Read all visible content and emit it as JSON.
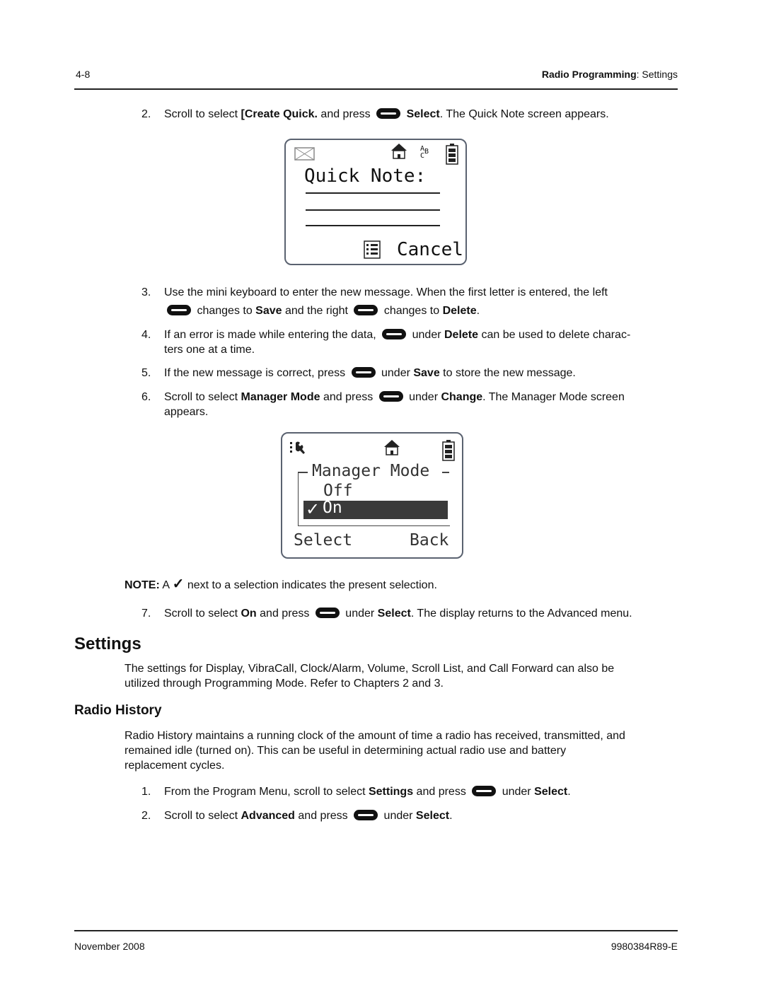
{
  "header": {
    "page_number": "4-8",
    "chapter": "Radio Programming",
    "separator": ": ",
    "section": "Settings"
  },
  "steps_top": [
    {
      "num": "2.",
      "parts": [
        "Scroll to select ",
        "[Create Quick.",
        " and press ",
        "Select",
        ". The Quick Note screen appears."
      ]
    }
  ],
  "quick_note_screen": {
    "title": "Quick Note:",
    "softkey_right": "Cancel",
    "abc_label": [
      "A",
      "B",
      "C"
    ]
  },
  "steps_mid": [
    {
      "num": "3.",
      "line1": "Use the mini keyboard to enter the new message. When the first letter is entered, the left",
      "a": " changes to ",
      "save": "Save",
      "b": " and the right ",
      "c": " changes to ",
      "delete": "Delete",
      "end": "."
    },
    {
      "num": "4.",
      "a": "If an error is made while entering the data, ",
      "b": " under ",
      "delete": "Delete",
      "c": " can be used to delete charac-",
      "line2": "ters one at a time."
    },
    {
      "num": "5.",
      "a": "If the new message is correct, press ",
      "b": " under ",
      "save": "Save",
      "c": " to store the new message."
    },
    {
      "num": "6.",
      "a": "Scroll to select ",
      "mm": "Manager Mode",
      "b": " and press ",
      "c": " under ",
      "change": "Change",
      "d": ". The Manager Mode screen",
      "line2": "appears."
    }
  ],
  "manager_screen": {
    "title": "Manager Mode",
    "options": [
      "Off",
      "On"
    ],
    "selected": "On",
    "softkey_left": "Select",
    "softkey_right": "Back"
  },
  "note": {
    "label": "NOTE:",
    "a": "A",
    "b": "next to a selection indicates the present selection."
  },
  "step7": {
    "num": "7.",
    "a": "Scroll to select ",
    "on": "On",
    "b": " and press ",
    "c": " under ",
    "select": "Select",
    "d": ". The display returns to the Advanced menu."
  },
  "settings": {
    "heading": "Settings",
    "body1": "The settings for Display, VibraCall, Clock/Alarm, Volume, Scroll List, and Call Forward can also be",
    "body2": "utilized through Programming Mode. Refer to Chapters 2 and 3."
  },
  "radio_history": {
    "heading": "Radio History",
    "body": [
      "Radio History maintains a running clock of the amount of time a radio has received, transmitted, and",
      "remained idle (turned on). This can be useful in determining actual radio use and battery",
      "replacement cycles."
    ],
    "steps": [
      {
        "num": "1.",
        "a": "From the Program Menu, scroll to select ",
        "bold1": "Settings",
        "b": " and press ",
        "c": " under ",
        "bold2": "Select",
        "d": "."
      },
      {
        "num": "2.",
        "a": "Scroll to select ",
        "bold1": "Advanced",
        "b": " and press ",
        "c": " under ",
        "bold2": "Select",
        "d": "."
      }
    ]
  },
  "footer": {
    "date": "November 2008",
    "doc_number": "9980384R89-E"
  }
}
